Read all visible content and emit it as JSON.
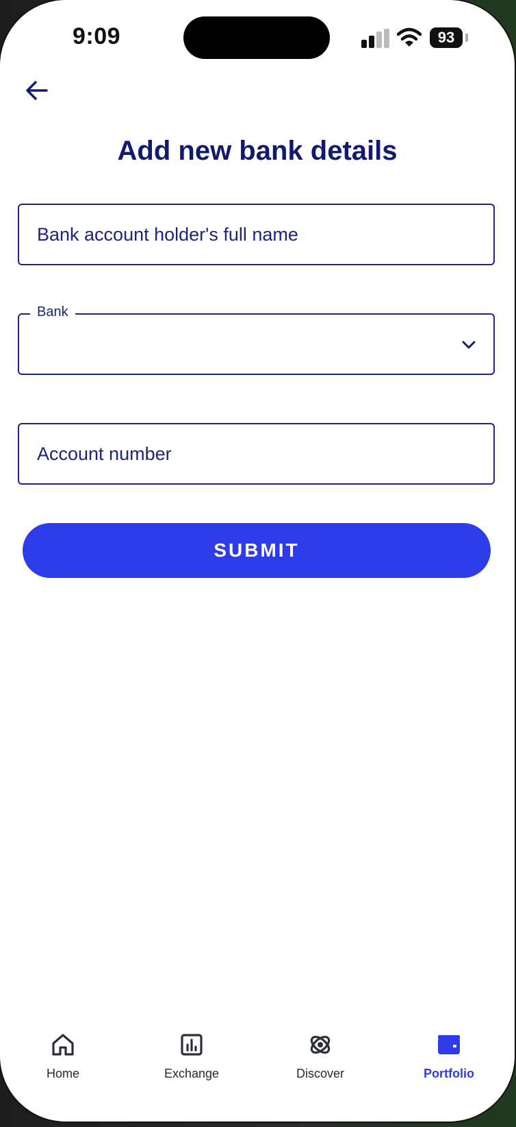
{
  "status_bar": {
    "time": "9:09",
    "battery": "93",
    "icons": [
      "cellular-signal-icon",
      "wifi-icon",
      "battery-icon"
    ]
  },
  "header": {
    "back_icon": "arrow-left-icon",
    "title": "Add new bank details"
  },
  "form": {
    "holder_name": {
      "placeholder": "Bank account holder's full name",
      "value": ""
    },
    "bank": {
      "label": "Bank",
      "value": "",
      "icon": "chevron-down-icon"
    },
    "account_number": {
      "placeholder": "Account number",
      "value": ""
    },
    "submit_label": "SUBMIT"
  },
  "bottom_nav": {
    "items": [
      {
        "label": "Home",
        "icon": "home-icon",
        "active": false
      },
      {
        "label": "Exchange",
        "icon": "bar-chart-icon",
        "active": false
      },
      {
        "label": "Discover",
        "icon": "orbit-icon",
        "active": false
      },
      {
        "label": "Portfolio",
        "icon": "wallet-icon",
        "active": true
      }
    ]
  },
  "colors": {
    "primary": "#2e3be8",
    "navy": "#1e2478",
    "title": "#111a6e",
    "background": "#ffffff"
  }
}
